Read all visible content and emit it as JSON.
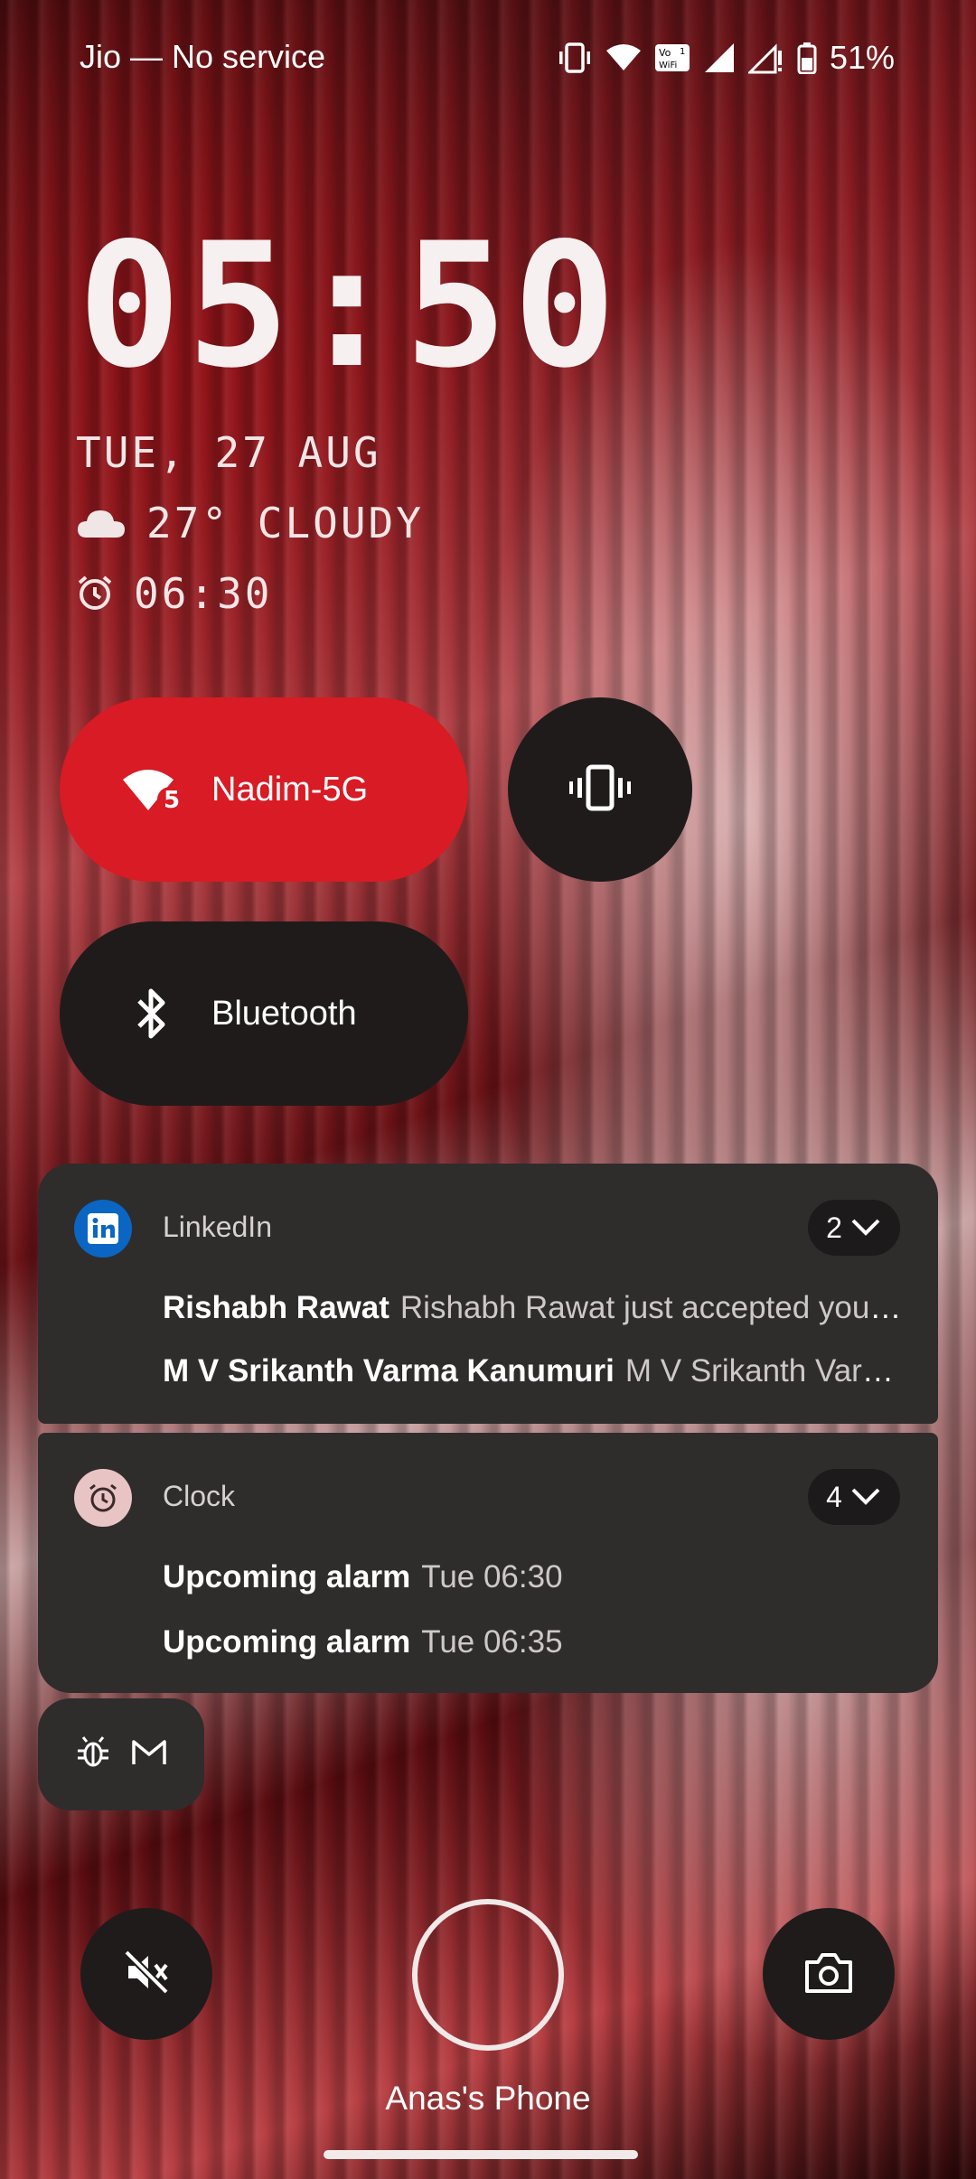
{
  "status_bar": {
    "carrier": "Jio — No service",
    "battery": "51%",
    "icons": [
      "vibrate-icon",
      "wifi-icon",
      "vowifi-icon",
      "signal-icon",
      "signal-no-service-icon",
      "battery-icon"
    ],
    "vowifi_label": "Vo WiFi"
  },
  "lockscreen": {
    "time": "05:50",
    "date": "TUE, 27 AUG",
    "weather": "27° CLOUDY",
    "alarm": "06:30"
  },
  "quick_tiles": {
    "wifi": {
      "label": "Nadim-5G",
      "badge": "5",
      "active": true
    },
    "vibrate": {
      "icon": "vibrate-icon"
    },
    "bluetooth": {
      "label": "Bluetooth",
      "active": false
    }
  },
  "notifications": [
    {
      "app": "LinkedIn",
      "count": "2",
      "items": [
        {
          "sender": "Rishabh Rawat",
          "message": "Rishabh Rawat just accepted your invitation"
        },
        {
          "sender": "M V Srikanth Varma Kanumuri",
          "message": "M V Srikanth Varma Kanumuri"
        }
      ]
    },
    {
      "app": "Clock",
      "count": "4",
      "items": [
        {
          "sender": "Upcoming alarm",
          "message": "Tue 06:30"
        },
        {
          "sender": "Upcoming alarm",
          "message": "Tue 06:35"
        }
      ]
    }
  ],
  "overflow_icons": [
    "bug-icon",
    "gmail-icon"
  ],
  "bottom": {
    "owner": "Anas's Phone"
  },
  "colors": {
    "accent": "#d81b24",
    "tile_dark": "#1f1b1b",
    "notification_bg": "#2f2c2c",
    "linkedin": "#0a66c2"
  }
}
